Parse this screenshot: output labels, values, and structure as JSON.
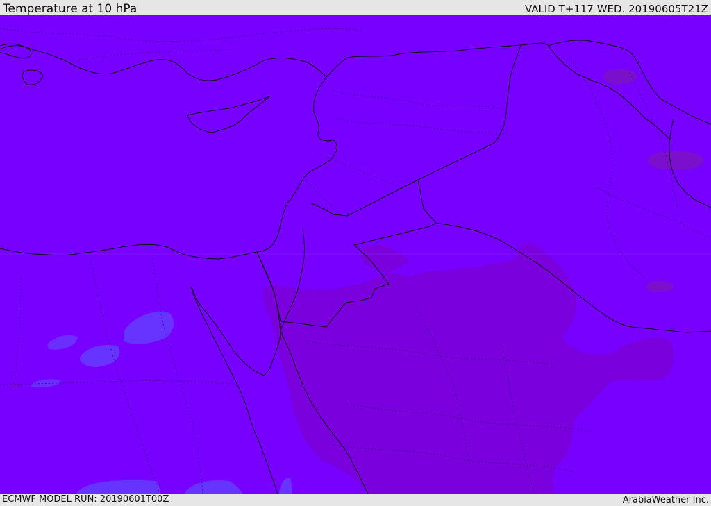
{
  "header": {
    "title": "Temperature at 10 hPa",
    "valid": "VALID T+117 WED. 20190605T21Z"
  },
  "footer": {
    "model_run": "ECMWF MODEL RUN: 20190601T00Z",
    "brand": "ArabiaWeather Inc."
  },
  "map": {
    "colors": {
      "base": "#7700ff",
      "warm": "#7a00dd",
      "warm_spot": "#7b10cc",
      "cool": "#6633ff",
      "cool_light": "#6a2eff"
    }
  }
}
